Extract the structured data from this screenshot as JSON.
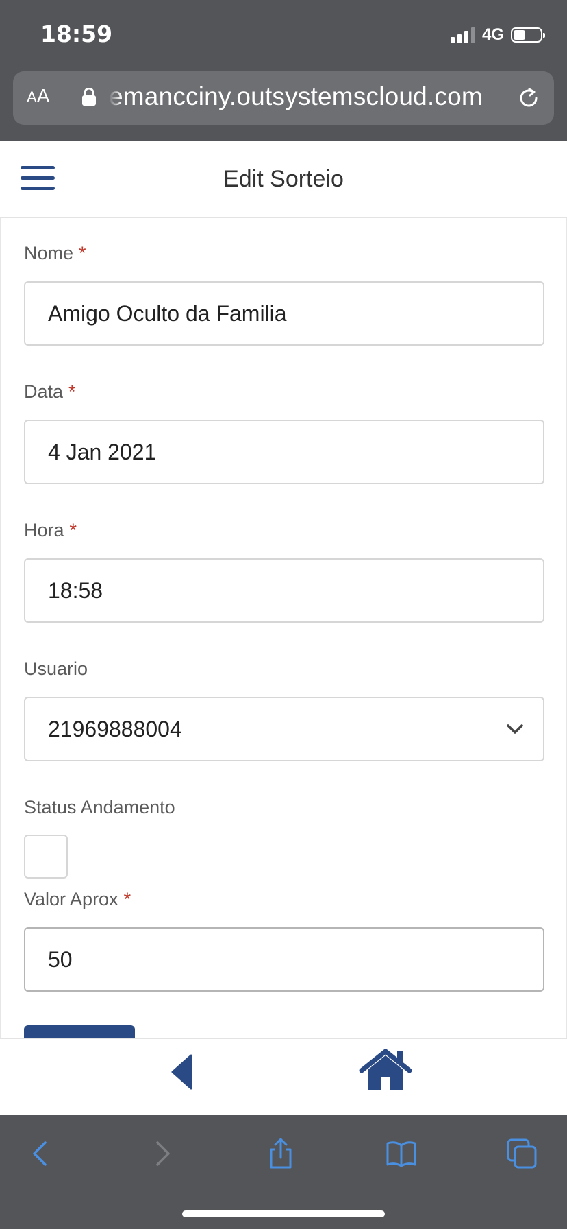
{
  "status_bar": {
    "time": "18:59",
    "network": "4G",
    "signal_bars": 3,
    "signal_bars_total": 4,
    "battery_level": 0.45
  },
  "browser": {
    "text_size_label": "AA",
    "url": "emancciny.outsystemscloud.com"
  },
  "header": {
    "title": "Edit Sorteio"
  },
  "form": {
    "nome": {
      "label": "Nome",
      "required_mark": "*",
      "value": "Amigo Oculto da Familia"
    },
    "data": {
      "label": "Data",
      "required_mark": "*",
      "value": "4 Jan 2021"
    },
    "hora": {
      "label": "Hora",
      "required_mark": "*",
      "value": "18:58"
    },
    "usuario": {
      "label": "Usuario",
      "value": "21969888004"
    },
    "status_andamento": {
      "label": "Status Andamento",
      "checked": false
    },
    "valor_aprox": {
      "label": "Valor Aprox",
      "required_mark": "*",
      "value": "50"
    }
  },
  "colors": {
    "brand": "#2a4a86",
    "required": "#c0392b",
    "safari_bar": "#545558",
    "safari_accent": "#4a90e2"
  },
  "icons": {
    "menu": "hamburger-icon",
    "back": "back-triangle-icon",
    "home": "home-icon",
    "toolbar": [
      "back-chevron-icon",
      "forward-chevron-icon",
      "share-icon",
      "bookmarks-icon",
      "tabs-icon"
    ]
  }
}
